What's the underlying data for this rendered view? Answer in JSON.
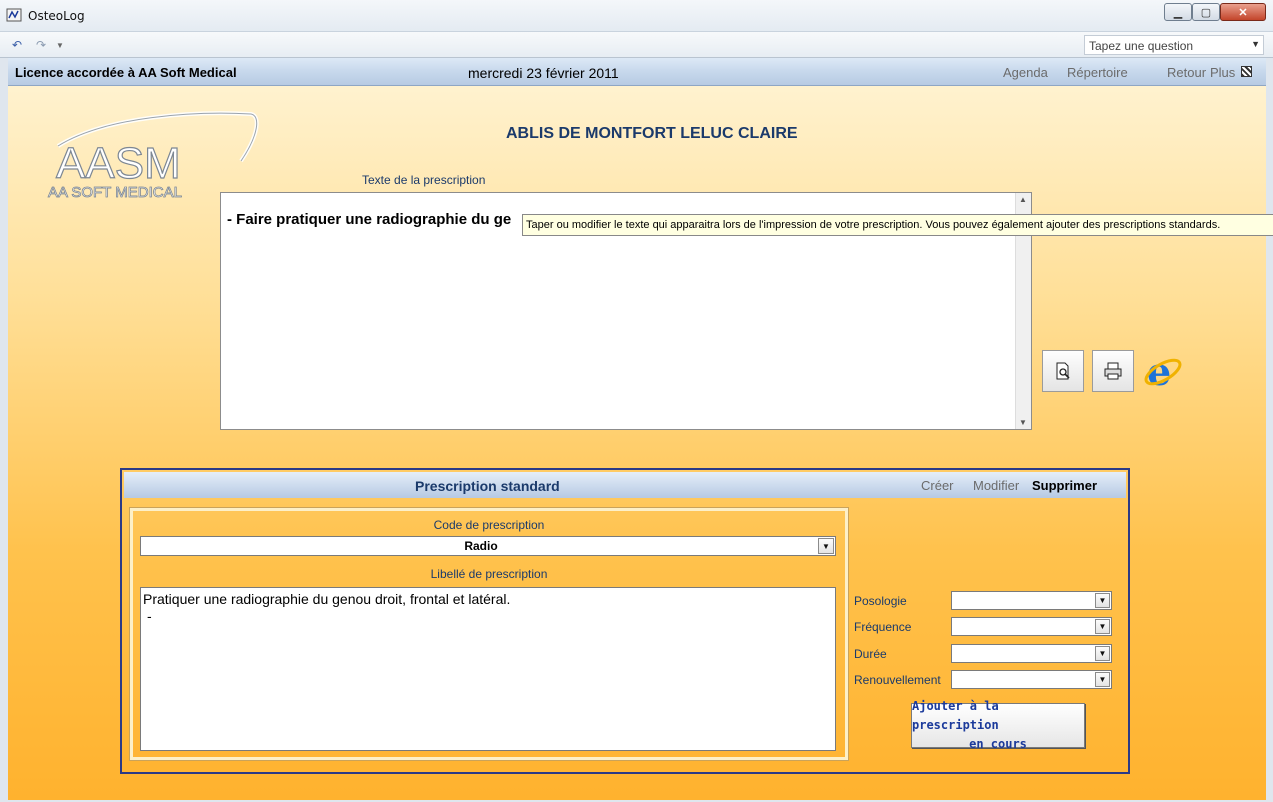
{
  "window": {
    "title": "OsteoLog",
    "minimize": "▁",
    "maximize": "▢",
    "close": "✕"
  },
  "toolbar": {
    "question_placeholder": "Tapez une question"
  },
  "header": {
    "license": "Licence accordée à AA Soft Medical",
    "date": "mercredi 23 février 2011",
    "nav": {
      "agenda": "Agenda",
      "repertoire": "Répertoire",
      "retour": "Retour",
      "plus": "Plus"
    }
  },
  "logo": {
    "main": "AASM",
    "sub": "AA SOFT MEDICAL"
  },
  "patient": {
    "name": "ABLIS DE MONTFORT LELUC CLAIRE"
  },
  "prescription": {
    "label": "Texte de la prescription",
    "text": "- Faire pratiquer une radiographie du ge",
    "tooltip": "Taper ou modifier le texte qui apparaitra lors de l'impression de votre prescription. Vous pouvez également ajouter des prescriptions standards."
  },
  "standard": {
    "title": "Prescription standard",
    "actions": {
      "creer": "Créer",
      "modifier": "Modifier",
      "supprimer": "Supprimer"
    },
    "code_label": "Code de prescription",
    "code_value": "Radio",
    "libelle_label": "Libellé de prescription",
    "libelle_line1": "Pratiquer une radiographie du genou droit, frontal et latéral.",
    "libelle_line2": "-",
    "fields": {
      "posologie": "Posologie",
      "frequence": "Fréquence",
      "duree": "Durée",
      "renouvellement": "Renouvellement"
    },
    "add_button": {
      "line1": "Ajouter à la prescription",
      "line2": "en cours"
    }
  },
  "colors": {
    "accent_blue": "#1b3a6b",
    "panel_border": "#2b3a86",
    "background_orange": "#ffc24d",
    "tooltip_bg": "#ffffe1"
  }
}
